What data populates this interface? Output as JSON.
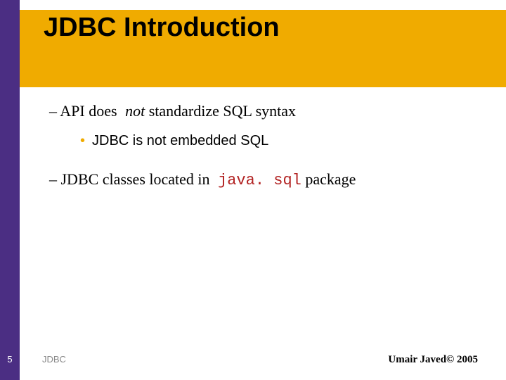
{
  "title": "JDBC Introduction",
  "bullets": {
    "line1_prefix": "– API does ",
    "line1_emph": "not",
    "line1_suffix": " standardize SQL syntax",
    "sub1": "JDBC is not embedded SQL",
    "line2_prefix": "– JDBC classes located in ",
    "line2_code": "java. sql",
    "line2_suffix": " package"
  },
  "footer": {
    "page": "5",
    "left": "JDBC",
    "right": "Umair Javed© 2005"
  }
}
